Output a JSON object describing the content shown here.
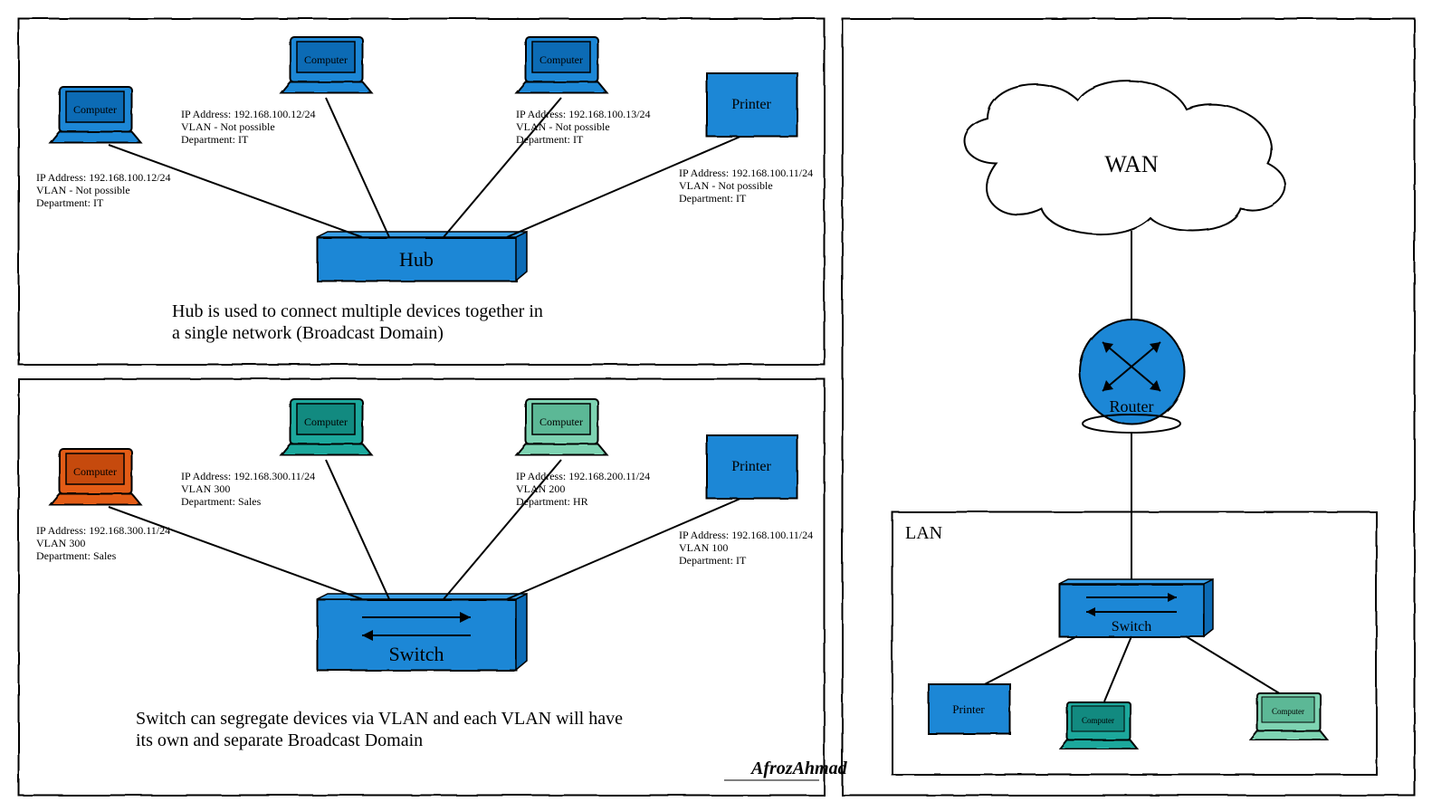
{
  "colors": {
    "blue": "#1f87d6",
    "blueDark": "#0c6bb5",
    "orange": "#e35c18",
    "teal": "#1aa89c",
    "mint": "#7ed3b2",
    "black": "#000000"
  },
  "strings": {
    "computer": "Computer",
    "printer": "Printer",
    "hub": "Hub",
    "switch": "Switch",
    "router": "Router",
    "wan": "WAN",
    "lan": "LAN",
    "author": "AfrozAhmad"
  },
  "hub": {
    "caption_line1": "Hub is used to connect multiple devices together in",
    "caption_line2": "a single network (Broadcast Domain)",
    "devices": [
      {
        "kind": "computer",
        "color": "blue",
        "ip": "IP Address: 192.168.100.12/24",
        "vlan": "VLAN - Not possible",
        "dept": "Department: IT"
      },
      {
        "kind": "computer",
        "color": "blue",
        "ip": "IP Address: 192.168.100.12/24",
        "vlan": "VLAN - Not possible",
        "dept": "Department: IT"
      },
      {
        "kind": "computer",
        "color": "blue",
        "ip": "IP Address: 192.168.100.13/24",
        "vlan": "VLAN - Not possible",
        "dept": "Department: IT"
      },
      {
        "kind": "printer",
        "color": "blue",
        "ip": "IP Address: 192.168.100.11/24",
        "vlan": "VLAN - Not possible",
        "dept": "Department: IT"
      }
    ]
  },
  "switch": {
    "caption_line1": "Switch can segregate devices via VLAN and each VLAN will have",
    "caption_line2": "its own and separate Broadcast Domain",
    "devices": [
      {
        "kind": "computer",
        "color": "orange",
        "ip": "IP Address: 192.168.300.11/24",
        "vlan": "VLAN 300",
        "dept": "Department: Sales"
      },
      {
        "kind": "computer",
        "color": "teal",
        "ip": "IP Address: 192.168.300.11/24",
        "vlan": "VLAN 300",
        "dept": "Department: Sales"
      },
      {
        "kind": "computer",
        "color": "mint",
        "ip": "IP Address: 192.168.200.11/24",
        "vlan": "VLAN 200",
        "dept": "Department: HR"
      },
      {
        "kind": "printer",
        "color": "blue",
        "ip": "IP Address: 192.168.100.11/24",
        "vlan": "VLAN 100",
        "dept": "Department: IT"
      }
    ]
  },
  "lan": {
    "devices": [
      {
        "kind": "printer",
        "color": "blue"
      },
      {
        "kind": "computer",
        "color": "teal"
      },
      {
        "kind": "computer",
        "color": "mint"
      }
    ]
  }
}
